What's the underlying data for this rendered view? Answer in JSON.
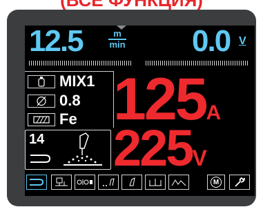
{
  "banner": {
    "text": "(ВСЕ ФУНКЦИЯ)"
  },
  "wire_speed": {
    "value": "12.5",
    "unit_top": "m",
    "unit_bottom": "min"
  },
  "voltage_set": {
    "value": "0.0",
    "unit": "V"
  },
  "params": {
    "mix": "MIX1",
    "diameter": "0.8",
    "material": "Fe",
    "program": "14"
  },
  "readout": {
    "current": "125",
    "current_unit": "A",
    "voltage": "225",
    "voltage_unit": "V"
  },
  "colors": {
    "accent": "#5fc8f2",
    "red": "#ee2a2e",
    "banner": "#e8252b"
  },
  "toolbar_icons": [
    "torch-trigger-icon",
    "synergic-curve-icon",
    "wire-inch-icon",
    "pre-gas-icon",
    "torch-icon",
    "spot-timer-icon",
    "arc-slope-icon",
    "memory-icon",
    "wrench-icon"
  ],
  "memory_label": "M"
}
